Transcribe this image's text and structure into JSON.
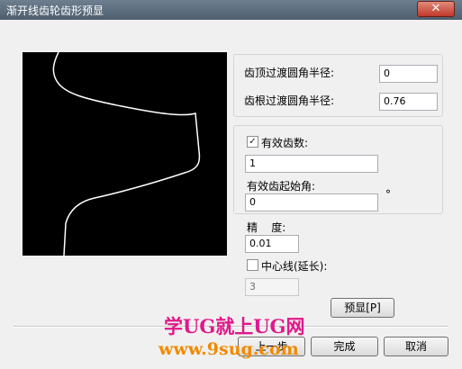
{
  "window": {
    "title": "渐开线齿轮齿形预显",
    "close_label": "✕"
  },
  "form": {
    "tip_fillet_label": "齿顶过渡圆角半径:",
    "tip_fillet_value": "0",
    "root_fillet_label": "齿根过渡圆角半径:",
    "root_fillet_value": "0.76",
    "effective_teeth_checked": true,
    "effective_teeth_label": "有效齿数:",
    "effective_teeth_value": "1",
    "start_angle_label": "有效齿起始角:",
    "start_angle_value": "0",
    "degree_symbol": "°",
    "precision_label": "精    度:",
    "precision_value": "0.01",
    "centerline_checked": false,
    "centerline_label": "中心线(延长):",
    "centerline_value": "3"
  },
  "buttons": {
    "preview": "预显[P]",
    "back": "上一步",
    "finish": "完成",
    "cancel": "取消"
  },
  "watermark": {
    "line1": "学UG就上UG网",
    "line2": "www.9sug.com"
  },
  "colors": {
    "preview_background": "#000000",
    "profile_stroke": "#ffffff",
    "watermark_text1": "#e0188a",
    "watermark_text2": "#f08a00"
  }
}
